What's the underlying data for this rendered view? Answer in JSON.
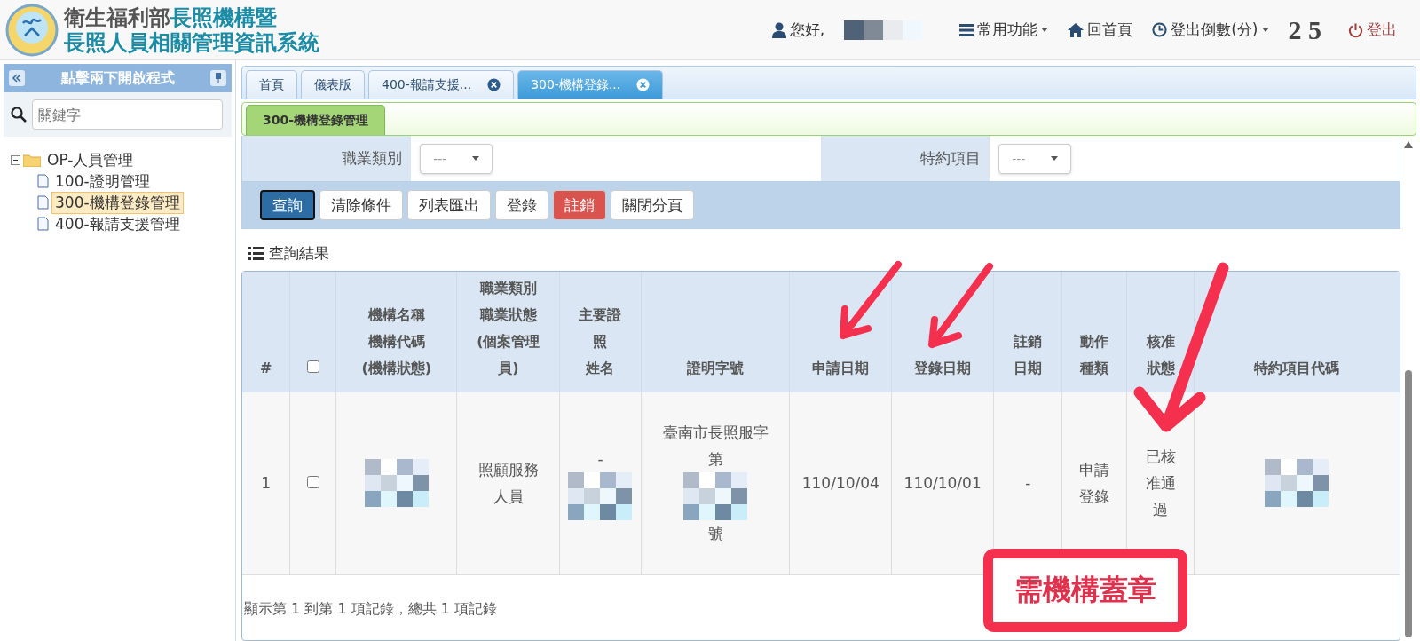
{
  "header": {
    "title_lines": [
      {
        "prefix": "衛生福利部",
        "suffix": "長照機構暨"
      },
      {
        "suffix": "長照人員相關管理資訊系統"
      }
    ],
    "greeting": "您好,",
    "menu": [
      {
        "kind": "menu",
        "label": "常用功能"
      },
      {
        "kind": "home",
        "label": "回首頁"
      },
      {
        "kind": "timer",
        "label": "登出倒數(分)"
      }
    ],
    "countdown": "2 5",
    "logout": "登出"
  },
  "sidebar": {
    "title": "點擊兩下開啟程式",
    "search_placeholder": "關鍵字",
    "tree": [
      {
        "label": "OP-人員管理",
        "expanded": true,
        "children": [
          {
            "label": "100-證明管理",
            "selected": false
          },
          {
            "label": "300-機構登錄管理",
            "selected": true
          },
          {
            "label": "400-報請支援管理",
            "selected": false
          }
        ]
      }
    ]
  },
  "tabs": [
    {
      "label": "首頁",
      "selected": false,
      "closable": false
    },
    {
      "label": "儀表版",
      "selected": false,
      "closable": false
    },
    {
      "label": "400-報請支援...",
      "selected": false,
      "closable": true
    },
    {
      "label": "300-機構登錄...",
      "selected": true,
      "closable": true
    }
  ],
  "subtab": "300-機構登錄管理",
  "filters": [
    {
      "label": "職業類別",
      "value": "---"
    },
    {
      "label": "特約項目",
      "value": "---"
    }
  ],
  "buttons": [
    {
      "label": "查詢",
      "kind": "primary"
    },
    {
      "label": "清除條件",
      "kind": "default"
    },
    {
      "label": "列表匯出",
      "kind": "default"
    },
    {
      "label": "登錄",
      "kind": "default"
    },
    {
      "label": "註銷",
      "kind": "danger"
    },
    {
      "label": "關閉分頁",
      "kind": "default"
    }
  ],
  "results": {
    "title": "查詢結果",
    "columns": [
      {
        "kind": "text",
        "lines": [
          "#"
        ]
      },
      {
        "kind": "checkbox",
        "checked": false
      },
      {
        "kind": "text",
        "lines": [
          "機構名稱",
          "機構代碼",
          "(機構狀態)"
        ]
      },
      {
        "kind": "text",
        "lines": [
          "職業類別",
          "職業狀態",
          "(個案管理",
          "員)"
        ]
      },
      {
        "kind": "text",
        "lines": [
          "主要證",
          "照",
          "姓名"
        ]
      },
      {
        "kind": "text",
        "lines": [
          "證明字號"
        ]
      },
      {
        "kind": "text",
        "lines": [
          "申請日期"
        ]
      },
      {
        "kind": "text",
        "lines": [
          "登錄日期"
        ]
      },
      {
        "kind": "text",
        "lines": [
          "註銷",
          "日期"
        ]
      },
      {
        "kind": "text",
        "lines": [
          "動作",
          "種類"
        ]
      },
      {
        "kind": "text",
        "lines": [
          "核准",
          "狀態"
        ]
      },
      {
        "kind": "text",
        "lines": [
          "特約項目代碼"
        ]
      }
    ],
    "rows": [
      {
        "cells": [
          {
            "kind": "text",
            "parts": [
              {
                "kind": "text",
                "text": "1"
              }
            ]
          },
          {
            "kind": "checkbox",
            "checked": false
          },
          {
            "kind": "text",
            "parts": [
              {
                "kind": "redacted"
              }
            ]
          },
          {
            "kind": "text",
            "parts": [
              {
                "kind": "text",
                "text": "照顧服務"
              },
              {
                "kind": "text",
                "text": "人員"
              }
            ]
          },
          {
            "kind": "text",
            "parts": [
              {
                "kind": "text",
                "text": "-"
              },
              {
                "kind": "redacted"
              }
            ]
          },
          {
            "kind": "text",
            "parts": [
              {
                "kind": "text",
                "text": "臺南市長照服字"
              },
              {
                "kind": "text",
                "text": "第"
              },
              {
                "kind": "redacted"
              },
              {
                "kind": "text",
                "text": "號"
              }
            ]
          },
          {
            "kind": "text",
            "parts": [
              {
                "kind": "text",
                "text": "110/10/04"
              }
            ]
          },
          {
            "kind": "text",
            "parts": [
              {
                "kind": "text",
                "text": "110/10/01"
              }
            ]
          },
          {
            "kind": "text",
            "parts": [
              {
                "kind": "text",
                "text": "-"
              }
            ]
          },
          {
            "kind": "text",
            "parts": [
              {
                "kind": "text",
                "text": "申請"
              },
              {
                "kind": "text",
                "text": "登錄"
              }
            ]
          },
          {
            "kind": "text",
            "parts": [
              {
                "kind": "text",
                "text": "已核"
              },
              {
                "kind": "text",
                "text": "准通"
              },
              {
                "kind": "text",
                "text": "過"
              }
            ]
          },
          {
            "kind": "text",
            "parts": [
              {
                "kind": "redacted"
              }
            ]
          }
        ]
      }
    ],
    "footer": "顯示第 1 到第 1 項記錄，總共 1 項記錄"
  },
  "annotation": {
    "note": "需機構蓋章"
  }
}
